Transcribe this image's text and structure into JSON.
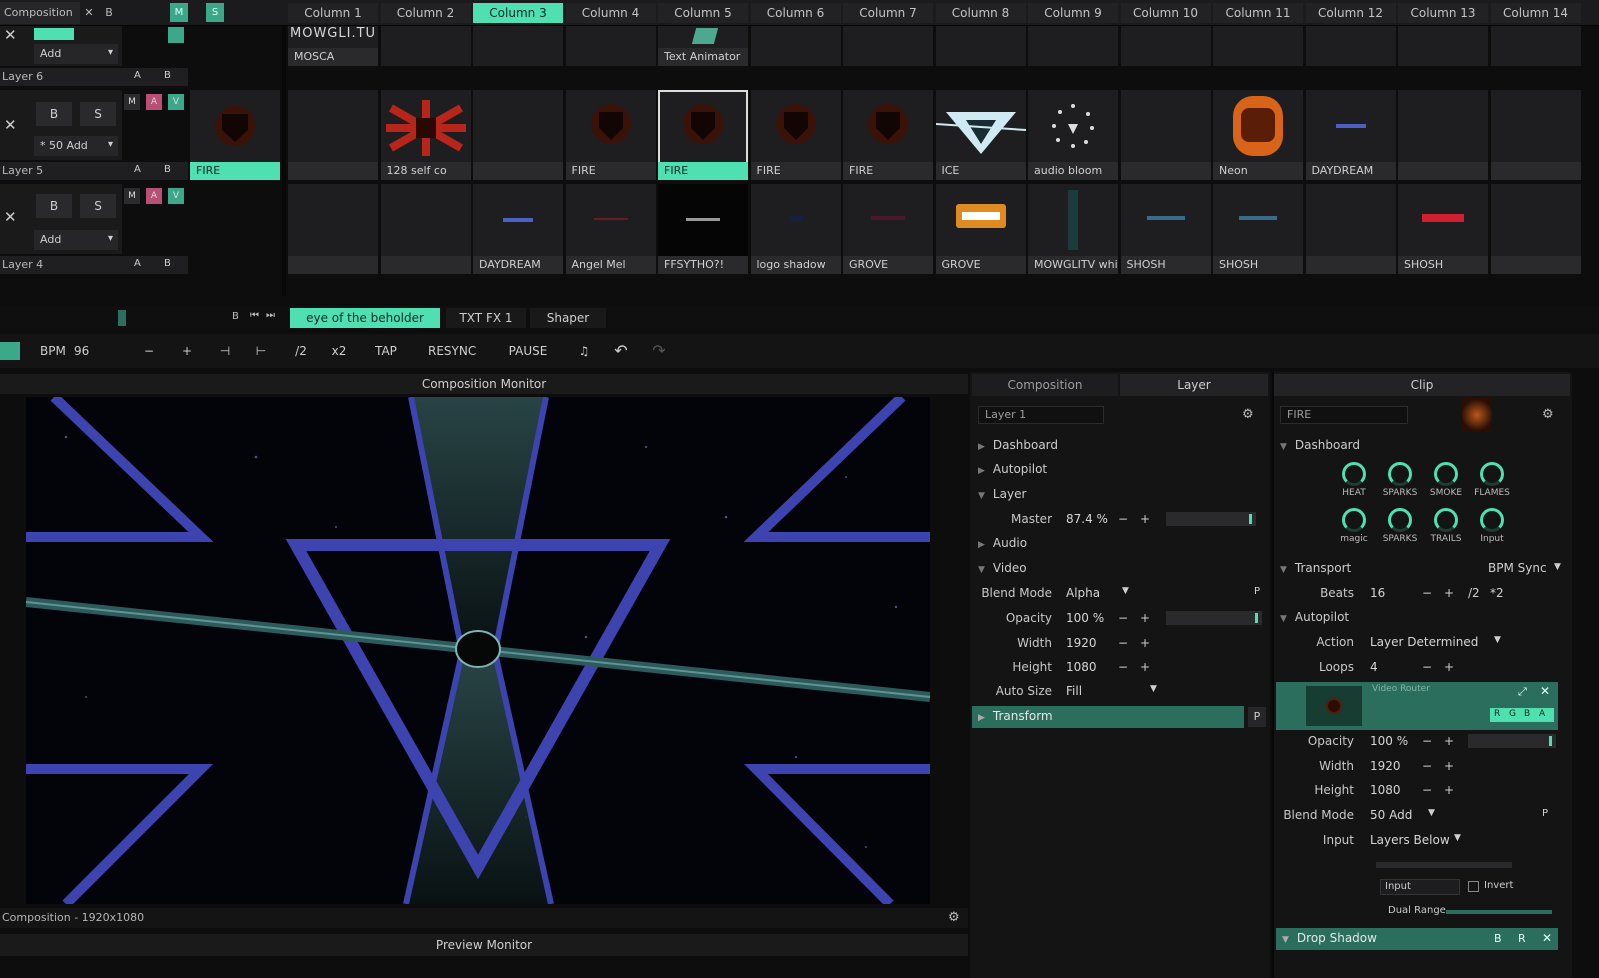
{
  "top": {
    "comp_label": "Composition",
    "x_label": "✕",
    "b_label": "B",
    "m_label": "M",
    "s_label": "S",
    "columns": [
      "Column 1",
      "Column 2",
      "Column 3",
      "Column 4",
      "Column 5",
      "Column 6",
      "Column 7",
      "Column 8",
      "Column 9",
      "Column 10",
      "Column 11",
      "Column 12",
      "Column 13",
      "Column 14"
    ],
    "active_column": "Column 3"
  },
  "layers": {
    "layer6": {
      "name": "Layer 6",
      "blend": "Add",
      "a": "A",
      "b": "B",
      "clips": [
        "MOSCA",
        "",
        "",
        "",
        "Text Animator",
        "",
        "",
        "",
        "",
        "",
        "",
        "",
        "",
        ""
      ],
      "header_text": "MOWGLI.TU"
    },
    "layer5": {
      "name": "Layer 5",
      "blend": "* 50 Add",
      "b_btn": "B",
      "s_btn": "S",
      "m": "M",
      "a_m": "A",
      "v": "V",
      "a": "A",
      "b": "B",
      "launch_clip": "FIRE",
      "clips": [
        "",
        "128 self co",
        "",
        "FIRE",
        "FIRE",
        "FIRE",
        "FIRE",
        "ICE",
        "audio bloom",
        "",
        "Neon",
        "DAYDREAM",
        "",
        ""
      ]
    },
    "layer4": {
      "name": "Layer 4",
      "blend": "Add",
      "b_btn": "B",
      "s_btn": "S",
      "m": "M",
      "a_m": "A",
      "v": "V",
      "a": "A",
      "b": "B",
      "clips": [
        "",
        "",
        "DAYDREAM",
        "Angel Mel",
        "FFSYTHO?!",
        "logo shadow",
        "GROVE",
        "GROVE",
        "MOWGLITV white...",
        "SHOSH",
        "SHOSH",
        "",
        "SHOSH",
        ""
      ]
    }
  },
  "deck": {
    "tabs": [
      "eye of the beholder",
      "TXT FX 1",
      "Shaper"
    ],
    "active": "eye of the beholder",
    "b": "B"
  },
  "transport": {
    "bpm_label": "BPM",
    "bpm_value": "96",
    "minus": "−",
    "plus": "+",
    "half": "/2",
    "double": "x2",
    "tap": "TAP",
    "resync": "RESYNC",
    "pause": "PAUSE"
  },
  "monitor": {
    "title": "Composition Monitor",
    "status": "Composition - 1920x1080",
    "preview": "Preview Monitor"
  },
  "layer_panel": {
    "tab_composition": "Composition",
    "tab_layer": "Layer",
    "layer_field": "Layer 1",
    "dashboard": "Dashboard",
    "autopilot": "Autopilot",
    "layer": "Layer",
    "master_label": "Master",
    "master_value": "87.4 %",
    "audio": "Audio",
    "video": "Video",
    "blend_mode_label": "Blend Mode",
    "blend_mode_value": "Alpha",
    "opacity_label": "Opacity",
    "opacity_value": "100 %",
    "width_label": "Width",
    "width_value": "1920",
    "height_label": "Height",
    "height_value": "1080",
    "autosize_label": "Auto Size",
    "autosize_value": "Fill",
    "transform": "Transform",
    "p": "P"
  },
  "clip_panel": {
    "title": "Clip",
    "clip_field": "FIRE",
    "dashboard": "Dashboard",
    "knobs_row1": [
      "HEAT",
      "SPARKS",
      "SMOKE",
      "FLAMES"
    ],
    "knobs_row2": [
      "magic",
      "SPARKS",
      "TRAILS",
      "Input"
    ],
    "transport": "Transport",
    "bpm_sync": "BPM Sync",
    "beats_label": "Beats",
    "beats_value": "16",
    "beats_half": "/2",
    "beats_double": "*2",
    "autopilot": "Autopilot",
    "action_label": "Action",
    "action_value": "Layer Determined",
    "loops_label": "Loops",
    "loops_value": "4",
    "fx_name": "Video Router",
    "rgba": [
      "R",
      "G",
      "B",
      "A"
    ],
    "opacity_label": "Opacity",
    "opacity_value": "100 %",
    "width_label": "Width",
    "width_value": "1920",
    "height_label": "Height",
    "height_value": "1080",
    "blend_label": "Blend Mode",
    "blend_value": "50 Add",
    "input_label": "Input",
    "input_value": "Layers Below",
    "input_sel": "Input",
    "invert": "Invert",
    "dual_range": "Dual Range",
    "dropshadow": "Drop Shadow",
    "b": "B",
    "r": "R",
    "x": "✕"
  },
  "colors": {
    "accent": "#4ee0b0",
    "accent_dark": "#2c6e5d",
    "layer_a": "#b84f74",
    "bg": "#0d0d0e"
  }
}
